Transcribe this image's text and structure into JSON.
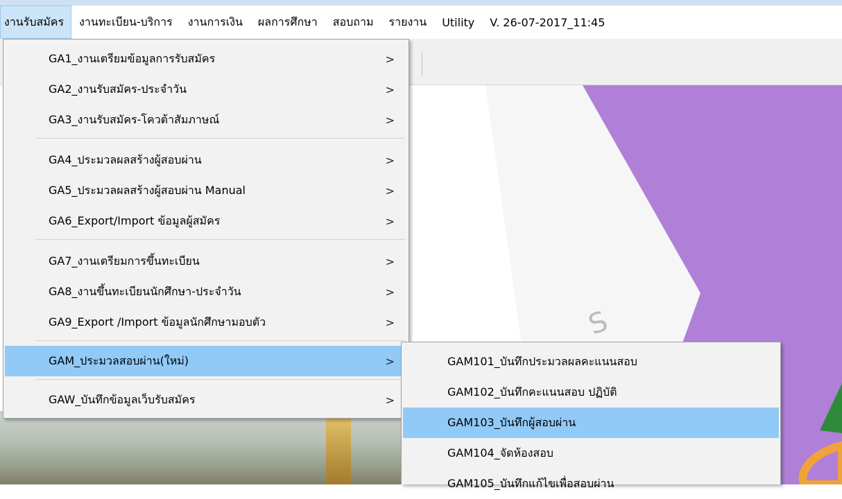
{
  "menubar": {
    "items": [
      {
        "label": "งานรับสมัคร",
        "active": true
      },
      {
        "label": "งานทะเบียน-บริการ"
      },
      {
        "label": "งานการเงิน"
      },
      {
        "label": "ผลการศึกษา"
      },
      {
        "label": "สอบถาม"
      },
      {
        "label": "รายงาน"
      },
      {
        "label": "Utility"
      },
      {
        "label": "V. 26-07-2017_11:45"
      }
    ]
  },
  "main_menu": {
    "items": [
      {
        "label": "GA1_งานเตรียมข้อมูลการรับสมัคร",
        "arrow": ">"
      },
      {
        "label": "GA2_งานรับสมัคร-ประจำวัน",
        "arrow": ">"
      },
      {
        "label": "GA3_งานรับสมัคร-โควต้าสัมภาษณ์",
        "arrow": ">"
      },
      {
        "label": "GA4_ประมวลผลสร้างผู้สอบผ่าน",
        "arrow": ">"
      },
      {
        "label": "GA5_ประมวลผลสร้างผู้สอบผ่าน Manual",
        "arrow": ">"
      },
      {
        "label": "GA6_Export/Import ข้อมูลผู้สมัคร",
        "arrow": ">"
      },
      {
        "label": "GA7_งานเตรียมการขึ้นทะเบียน",
        "arrow": ">"
      },
      {
        "label": "GA8_งานขึ้นทะเบียนนักศึกษา-ประจำวัน",
        "arrow": ">"
      },
      {
        "label": "GA9_Export /Import ข้อมูลนักศึกษามอบตัว",
        "arrow": ">"
      },
      {
        "label": "GAM_ประมวลสอบผ่าน(ใหม่)",
        "arrow": ">",
        "highlighted": true
      },
      {
        "label": "GAW_บันทึกข้อมูลเว็บรับสมัคร",
        "arrow": ">"
      }
    ]
  },
  "sub_menu": {
    "items": [
      {
        "label": "GAM101_บันทึกประมวลผลคะแนนสอบ"
      },
      {
        "label": "GAM102_บันทึกคะแนนสอบ ปฏิบัติ"
      },
      {
        "label": "GAM103_บันทึกผู้สอบผ่าน",
        "highlighted": true
      },
      {
        "label": "GAM104_จัดห้องสอบ"
      },
      {
        "label": "GAM105_บันทึกแก้ไขเพื่อสอบผ่าน"
      }
    ]
  },
  "colors": {
    "menu_highlight": "#91c9f7",
    "menubar_active": "#cce4f7",
    "splash_purple": "#b07fd7"
  }
}
